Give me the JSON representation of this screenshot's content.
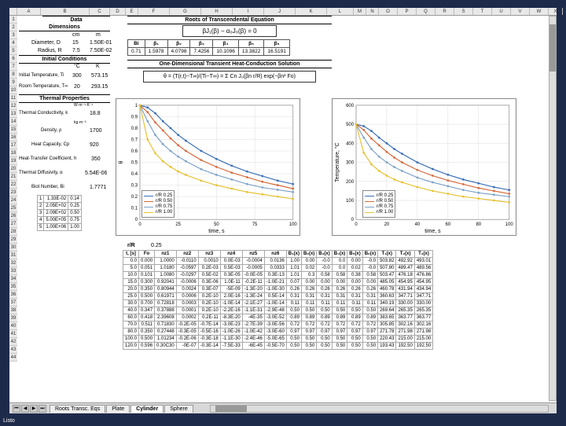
{
  "columns": [
    "A",
    "B",
    "C",
    "D",
    "E",
    "F",
    "G",
    "H",
    "I",
    "J",
    "K",
    "L",
    "M",
    "N",
    "O",
    "P",
    "Q",
    "R",
    "S",
    "T",
    "U",
    "V",
    "W",
    "X"
  ],
  "rows_visible": 44,
  "sections": {
    "data_hdr": "Data",
    "dimensions_hdr": "Dimensions",
    "initial_cond_hdr": "Initial Conditions",
    "thermal_props_hdr": "Thermal Properties",
    "roots_hdr": "Roots of Transcendental Equation",
    "roots_eq": "βJ₁(β) − α₀J₀(β) = 0",
    "solution_hdr": "One-Dimensional Transient Heat-Conduction Solution"
  },
  "params": {
    "diameter_label": "Diameter, D",
    "diameter_cm": "15",
    "diameter_m": "1.50E-01",
    "radius_label": "Radius, R",
    "radius_cm": "7.5",
    "radius_m": "7.50E-02",
    "Ti_label": "Initial Temperature, Ti",
    "Ti_C": "300",
    "Ti_K": "573.15",
    "Tinf_label": "Room Temperature, T∞",
    "Tinf_C": "20",
    "Tinf_K": "293.15",
    "k_label": "Thermal Conductivity, k",
    "k_val": "18.8",
    "rho_label": "Density, ρ",
    "rho_val": "1700",
    "cp_label": "Heat Capacity, Cp",
    "cp_val": "920",
    "h_label": "Heat-Transfer Coefficient, h",
    "h_val": "350",
    "alpha_label": "Thermal Diffusivity, α",
    "alpha_val": "5.54E-06",
    "Bi_label": "Biot Number, Bi",
    "Bi_val": "1.7771",
    "lambda_tbl": [
      [
        "1",
        "1.33E-02",
        "0.14"
      ],
      [
        "2",
        "2.05E+02",
        "0.25"
      ],
      [
        "3",
        "2.09E+02",
        "0.50"
      ],
      [
        "4",
        "5.00E+05",
        "0.75"
      ],
      [
        "5",
        "1.00E+06",
        "1.00"
      ]
    ]
  },
  "roots_row": {
    "Bi_label": "Bi",
    "labels": [
      "β₁",
      "β₂",
      "β₃",
      "β₄",
      "β₅",
      "β₆"
    ],
    "Bi": "0.71",
    "vals": [
      "1.5978",
      "4.0798",
      "7.4256",
      "10.1096",
      "13.3822",
      "16.5191"
    ]
  },
  "solution_eq": "θ = (T(r,t)−T∞)/(Ti−T∞) = Σ Cn J₀(βn r/R) exp(−βn² Fo)",
  "chart_data": [
    {
      "type": "line",
      "title": "",
      "xlabel": "time, s",
      "ylabel": "θ",
      "xlim": [
        0,
        100
      ],
      "ylim": [
        0.0,
        1.0
      ],
      "xticks": [
        0,
        25,
        50,
        75,
        100
      ],
      "yticks": [
        0.0,
        0.1,
        0.2,
        0.3,
        0.4,
        0.5,
        0.6,
        0.7,
        0.8,
        0.9,
        1.0
      ],
      "series": [
        {
          "name": "r/R 0.25",
          "color": "#3b6fb6",
          "x": [
            0,
            5,
            10,
            15,
            20,
            25,
            30,
            40,
            50,
            60,
            70,
            80,
            90,
            100
          ],
          "y": [
            1.0,
            0.98,
            0.93,
            0.86,
            0.8,
            0.74,
            0.69,
            0.6,
            0.53,
            0.47,
            0.42,
            0.38,
            0.34,
            0.31
          ]
        },
        {
          "name": "r/R 0.50",
          "color": "#d66a3a",
          "x": [
            0,
            5,
            10,
            15,
            20,
            25,
            30,
            40,
            50,
            60,
            70,
            80,
            90,
            100
          ],
          "y": [
            1.0,
            0.94,
            0.85,
            0.78,
            0.71,
            0.65,
            0.6,
            0.52,
            0.46,
            0.41,
            0.37,
            0.33,
            0.3,
            0.27
          ]
        },
        {
          "name": "r/R 0.75",
          "color": "#7ea3c9",
          "x": [
            0,
            5,
            10,
            15,
            20,
            25,
            30,
            40,
            50,
            60,
            70,
            80,
            90,
            100
          ],
          "y": [
            1.0,
            0.86,
            0.74,
            0.66,
            0.6,
            0.55,
            0.51,
            0.44,
            0.39,
            0.35,
            0.31,
            0.28,
            0.26,
            0.24
          ]
        },
        {
          "name": "r/R 1.00",
          "color": "#e6c233",
          "x": [
            0,
            5,
            10,
            15,
            20,
            25,
            30,
            40,
            50,
            60,
            70,
            80,
            90,
            100
          ],
          "y": [
            1.0,
            0.7,
            0.58,
            0.51,
            0.46,
            0.42,
            0.39,
            0.34,
            0.3,
            0.27,
            0.24,
            0.22,
            0.2,
            0.18
          ]
        }
      ]
    },
    {
      "type": "line",
      "title": "",
      "xlabel": "time, s",
      "ylabel": "Temperature, °C",
      "xlim": [
        0,
        100
      ],
      "ylim": [
        0,
        600
      ],
      "xticks": [
        0,
        20,
        40,
        60,
        80,
        100
      ],
      "yticks": [
        0,
        100,
        200,
        300,
        400,
        500,
        600
      ],
      "series": [
        {
          "name": "r/R 0.25",
          "color": "#3b6fb6",
          "x": [
            0,
            5,
            10,
            15,
            20,
            25,
            30,
            40,
            50,
            60,
            70,
            80,
            90,
            100
          ],
          "y": [
            500,
            490,
            465,
            430,
            400,
            370,
            345,
            300,
            265,
            235,
            210,
            190,
            170,
            155
          ]
        },
        {
          "name": "r/R 0.50",
          "color": "#d66a3a",
          "x": [
            0,
            5,
            10,
            15,
            20,
            25,
            30,
            40,
            50,
            60,
            70,
            80,
            90,
            100
          ],
          "y": [
            500,
            470,
            425,
            390,
            355,
            325,
            300,
            260,
            230,
            205,
            185,
            165,
            150,
            135
          ]
        },
        {
          "name": "r/R 0.75",
          "color": "#7ea3c9",
          "x": [
            0,
            5,
            10,
            15,
            20,
            25,
            30,
            40,
            50,
            60,
            70,
            80,
            90,
            100
          ],
          "y": [
            500,
            430,
            370,
            330,
            300,
            275,
            255,
            220,
            195,
            175,
            155,
            140,
            130,
            120
          ]
        },
        {
          "name": "r/R 1.00",
          "color": "#e6c233",
          "x": [
            0,
            5,
            10,
            15,
            20,
            25,
            30,
            40,
            50,
            60,
            70,
            80,
            90,
            100
          ],
          "y": [
            500,
            350,
            290,
            255,
            230,
            210,
            195,
            170,
            150,
            135,
            120,
            110,
            100,
            90
          ]
        }
      ]
    }
  ],
  "bottom_table": {
    "top_left_label": "r/R",
    "top_left_val": "0.25",
    "headers": [
      "t, [s]",
      "Fo",
      "nz1",
      "nz2",
      "nz3",
      "nz4",
      "nz5",
      "nz6",
      "B₁(x)",
      "B₂(x)",
      "B₃(x)",
      "B₄(x)",
      "B₅(x)",
      "B₆(x)",
      "T₁(x)",
      "T₂(x)",
      "T₃(x)"
    ],
    "rows": [
      [
        "0.0",
        "0.000",
        "1.0000",
        "-0.0110",
        "0.0010",
        "0.0E-03",
        "-0.0004",
        "0.0136",
        "1.00",
        "0.00",
        "-0.0",
        "0.0",
        "0.00",
        "-0.0",
        "503.82",
        "492.92",
        "493.01"
      ],
      [
        "5.0",
        "0.051",
        "1.0180",
        "-0.0597",
        "0.2E-03",
        "0.5E-03",
        "-0.0005",
        "0.0333",
        "1.01",
        "0.02",
        "-0.0",
        "0.0",
        "0.02",
        "-0.0",
        "507.80",
        "489.47",
        "489.56"
      ],
      [
        "10.0",
        "0.101",
        "1.0080",
        "-0.0297",
        "0.5E-02",
        "0.3E-05",
        "-0.0E-05",
        "0.3E-13",
        "1.01",
        "0.3",
        "0.58",
        "0.58",
        "0.38",
        "0.58",
        "503.47",
        "476.18",
        "476.86"
      ],
      [
        "15.0",
        "0.300",
        "0.92041",
        "-0.0006",
        "0.3E-06",
        "1.0E-11",
        "-0.2E-11",
        "-1.0E-21",
        "0.07",
        "0.00",
        "0.00",
        "0.00",
        "0.00",
        "0.00",
        "485.05",
        "454.95",
        "454.95"
      ],
      [
        "20.0",
        "0.350",
        "0.80944",
        "0.0024",
        "0.3E-07",
        "-5E-09",
        "-1.3E-20",
        "-1.0E-30",
        "0.26",
        "0.26",
        "0.26",
        "0.26",
        "0.26",
        "0.26",
        "460.78",
        "431.94",
        "434.94"
      ],
      [
        "25.0",
        "0.500",
        "0.61971",
        "0.0006",
        "0.2E-10",
        "2.0E-16",
        "-1.3E-24",
        "0.5E-14",
        "0.31",
        "0.31",
        "0.31",
        "0.31",
        "0.31",
        "0.31",
        "360.63",
        "347.71",
        "347.71"
      ],
      [
        "30.0",
        "0.700",
        "0.72818",
        "0.0003",
        "0.2E-10",
        "-1.0E-14",
        "-2.1E-27",
        "-1.0E-14",
        "0.11",
        "0.11",
        "0.11",
        "0.11",
        "0.11",
        "0.11",
        "340.19",
        "330.00",
        "330.00"
      ],
      [
        "40.0",
        "0.347",
        "0.37888",
        "0.0001",
        "0.2E-10",
        "-2.2E-16",
        "-1.1E-31",
        "-2.9E-48",
        "0.50",
        "0.50",
        "0.50",
        "0.50",
        "0.50",
        "0.50",
        "269.64",
        "265.35",
        "265.35"
      ],
      [
        "60.0",
        "0.418",
        "2.39608",
        "0.0002",
        "0.2E-11",
        "-8.3E-20",
        "-4E-35",
        "-3.0E-52",
        "0.89",
        "0.89",
        "0.89",
        "0.89",
        "0.89",
        "0.89",
        "383.65",
        "363.77",
        "363.77"
      ],
      [
        "70.0",
        "0.511",
        "0.71830",
        "-0.2E-05",
        "-0.7E-14",
        "-3.0E-23",
        "-2.7E-39",
        "-3.0E-56",
        "0.72",
        "0.72",
        "0.72",
        "0.72",
        "0.72",
        "0.72",
        "305.85",
        "302.16",
        "302.16"
      ],
      [
        "80.0",
        "0.350",
        "0.27448",
        "-0.3E-05",
        "-0.5E-16",
        "-1.0E-26",
        "-1.0E-42",
        "-3.0E-60",
        "0.97",
        "0.97",
        "0.97",
        "0.97",
        "0.97",
        "0.97",
        "271.78",
        "271.98",
        "271.98"
      ],
      [
        "100.0",
        "0.500",
        "1.01234",
        "-0.2E-06",
        "-0.3E-18",
        "-1.1E-30",
        "-2.4E-46",
        "-5.0E-65",
        "0.50",
        "0.50",
        "0.50",
        "0.50",
        "0.50",
        "0.50",
        "220.43",
        "215.00",
        "215.00"
      ],
      [
        "120.0",
        "0.596",
        "0.30C30",
        "-0E-07",
        "-0.3E-14",
        "-7.5E-33",
        "-6E-45",
        "-0.5E-70",
        "0.50",
        "0.50",
        "0.50",
        "0.50",
        "0.50",
        "0.50",
        "193.43",
        "192.50",
        "192.50"
      ]
    ]
  },
  "tabs": [
    "Roots Transc. Eqs",
    "Plate",
    "Cylinder",
    "Sphere"
  ],
  "active_tab": 2,
  "status": "Listo"
}
